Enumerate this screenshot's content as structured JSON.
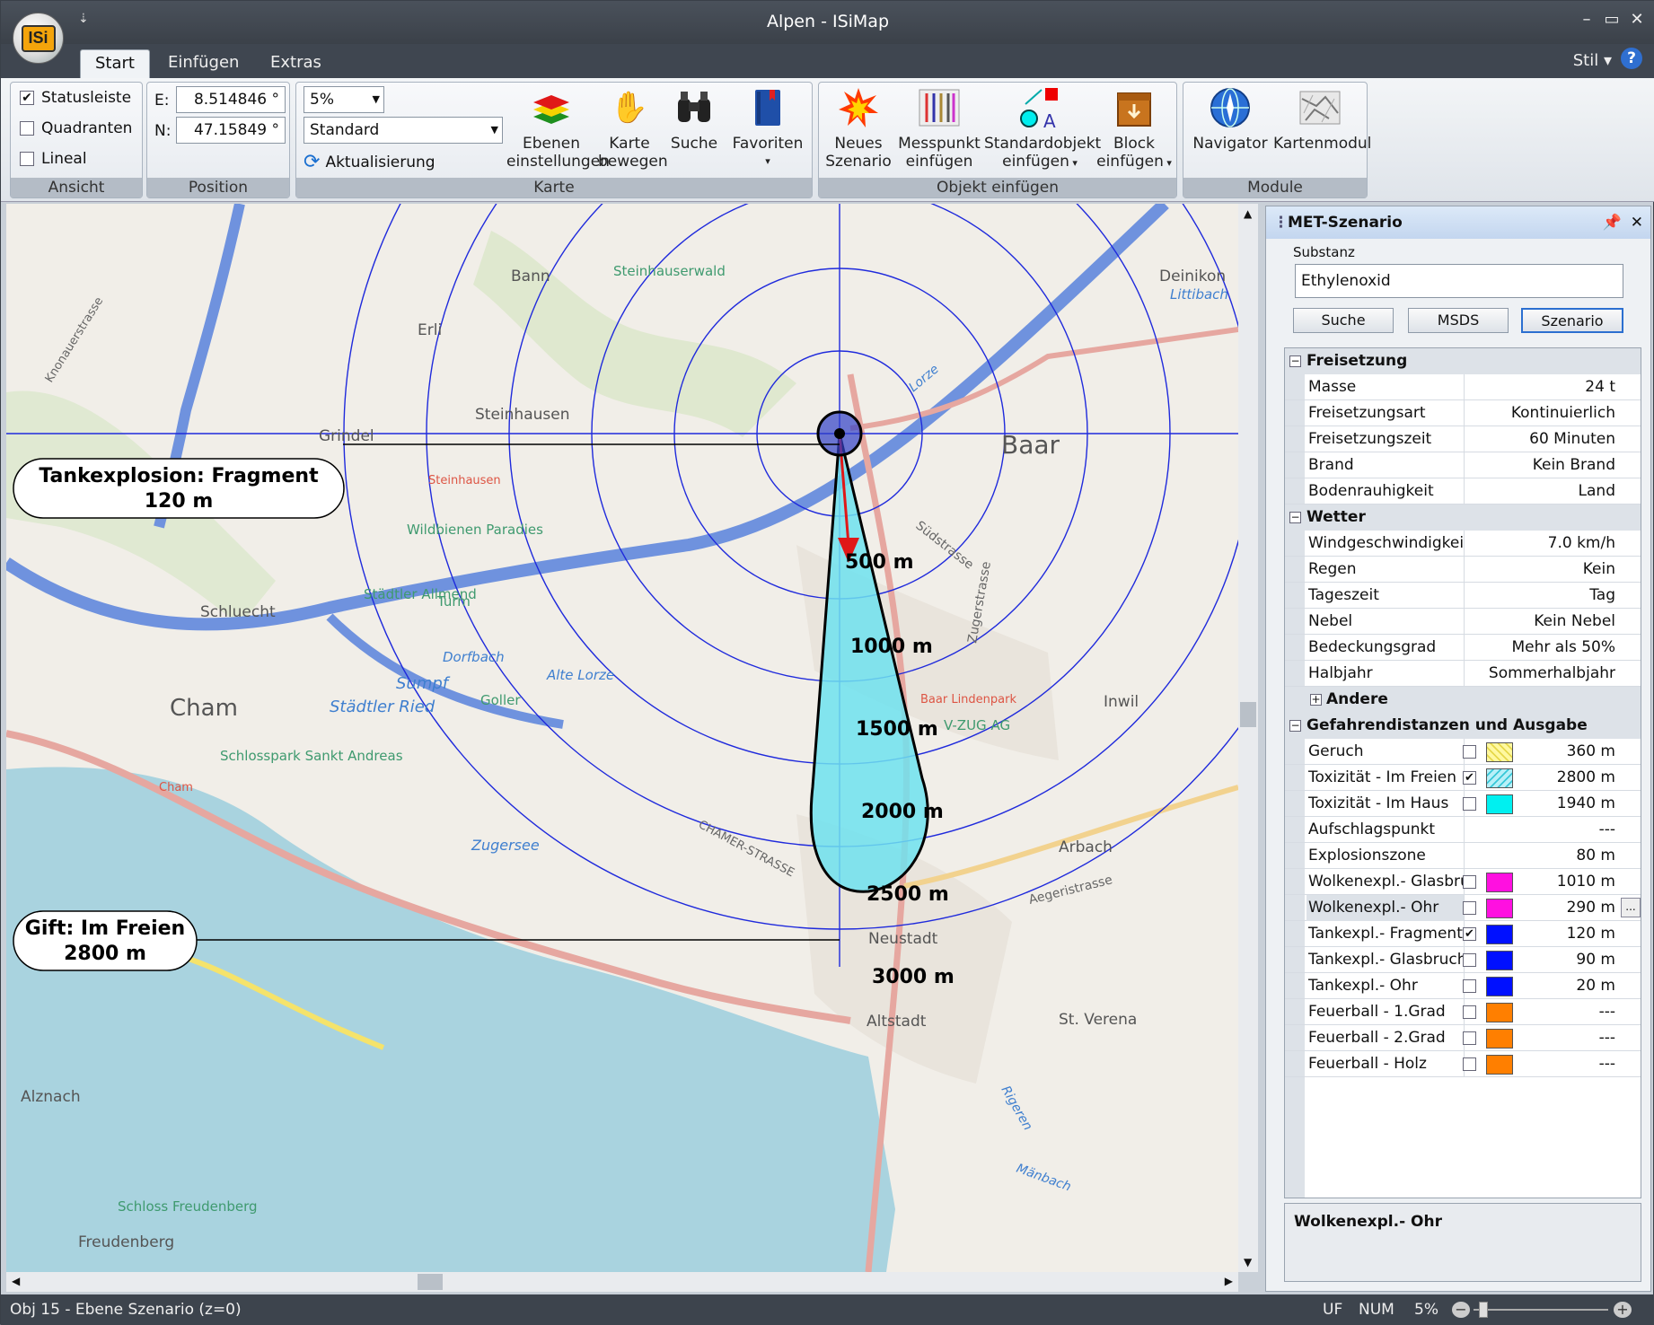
{
  "window": {
    "title": "Alpen - ISiMap",
    "logo": "ISi"
  },
  "tabs": [
    "Start",
    "Einfügen",
    "Extras"
  ],
  "style_menu": "Stil",
  "ribbon": {
    "ansicht": {
      "caption": "Ansicht",
      "items": [
        {
          "label": "Statusleiste",
          "checked": true
        },
        {
          "label": "Quadranten",
          "checked": false
        },
        {
          "label": "Lineal",
          "checked": false
        }
      ]
    },
    "position": {
      "caption": "Position",
      "e_label": "E:",
      "e_value": "8.514846 °",
      "n_label": "N:",
      "n_value": "47.15849 °"
    },
    "karte": {
      "caption": "Karte",
      "zoom": "5%",
      "style": "Standard",
      "refresh": "Aktualisierung",
      "btn_layers_1": "Ebenen",
      "btn_layers_2": "einstellungen",
      "btn_move_1": "Karte",
      "btn_move_2": "bewegen",
      "btn_search": "Suche",
      "btn_fav": "Favoriten"
    },
    "objekt": {
      "caption": "Objekt einfügen",
      "b1a": "Neues",
      "b1b": "Szenario",
      "b2a": "Messpunkt",
      "b2b": "einfügen",
      "b3a": "Standardobjekt",
      "b3b": "einfügen",
      "b4a": "Block",
      "b4b": "einfügen"
    },
    "module": {
      "caption": "Module",
      "b1": "Navigator",
      "b2": "Kartenmodul"
    }
  },
  "map": {
    "callout1": {
      "line1": "Tankexplosion: Fragment",
      "line2": "120 m"
    },
    "callout2": {
      "line1": "Gift: Im Freien",
      "line2": "2800 m"
    },
    "rings": [
      {
        "label": "500 m",
        "r": 500
      },
      {
        "label": "1000 m",
        "r": 1000
      },
      {
        "label": "1500 m",
        "r": 1500
      },
      {
        "label": "2000 m",
        "r": 2000
      },
      {
        "label": "2500 m",
        "r": 2500
      },
      {
        "label": "3000 m",
        "r": 3000
      }
    ],
    "places": [
      "Bann",
      "Erli",
      "Grindel",
      "Steinhausen",
      "Steinhauserwald",
      "Deinikon",
      "Littibach",
      "Baar",
      "Schluecht",
      "Cham",
      "Städtler Ried",
      "Sumpf",
      "Alte Lorze",
      "Goller",
      "Städtler Allmend",
      "Turm",
      "Dorfbach",
      "Wildbienen Paradies",
      "Schlosspark Sankt Andreas",
      "Zugersee",
      "Inwil",
      "V-ZUG AG",
      "Arbach",
      "Neustadt",
      "Altstadt",
      "St. Verena",
      "Alznach",
      "Schloss Freudenberg",
      "Freudenberg",
      "Knonauerstrasse",
      "Zugerstrasse",
      "Südstrasse",
      "Aegeristrasse",
      "CHAMER-STRASSE",
      "Lorze",
      "Baar Lindenpark",
      "Steinhausen",
      "Cham",
      "Rigeren",
      "Mänbach"
    ]
  },
  "panel": {
    "title": "MET-Szenario",
    "substance_label": "Substanz",
    "substance": "Ethylenoxid",
    "btn_search": "Suche",
    "btn_msds": "MSDS",
    "btn_scenario": "Szenario",
    "cat_release": "Freisetzung",
    "release": [
      [
        "Masse",
        "24 t"
      ],
      [
        "Freisetzungsart",
        "Kontinuierlich"
      ],
      [
        "Freisetzungszeit",
        "60 Minuten"
      ],
      [
        "Brand",
        "Kein Brand"
      ],
      [
        "Bodenrauhigkeit",
        "Land"
      ]
    ],
    "cat_weather": "Wetter",
    "weather": [
      [
        "Windgeschwindigkeit",
        "7.0 km/h"
      ],
      [
        "Regen",
        "Kein"
      ],
      [
        "Tageszeit",
        "Tag"
      ],
      [
        "Nebel",
        "Kein Nebel"
      ],
      [
        "Bedeckungsgrad",
        "Mehr als 50%"
      ],
      [
        "Halbjahr",
        "Sommerhalbjahr"
      ]
    ],
    "cat_other": "Andere",
    "cat_hazard": "Gefahrendistanzen und Ausgabe",
    "hazard": [
      {
        "k": "Geruch",
        "v": "360 m",
        "checked": false,
        "color": "#fff8a0"
      },
      {
        "k": "Toxizität - Im Freien",
        "v": "2800 m",
        "checked": true,
        "color": "#b8f0f8"
      },
      {
        "k": "Toxizität - Im Haus",
        "v": "1940 m",
        "checked": false,
        "color": "#00f0f0"
      },
      {
        "k": "Aufschlagspunkt",
        "v": "---",
        "checked": null,
        "color": null
      },
      {
        "k": "Explosionszone",
        "v": "80 m",
        "checked": null,
        "color": null
      },
      {
        "k": "Wolkenexpl.- Glasbru",
        "v": "1010 m",
        "checked": false,
        "color": "#ff10e0"
      },
      {
        "k": "Wolkenexpl.- Ohr",
        "v": "290 m",
        "checked": false,
        "color": "#ff10e0"
      },
      {
        "k": "Tankexpl.- Fragment",
        "v": "120 m",
        "checked": true,
        "color": "#0010ff"
      },
      {
        "k": "Tankexpl.- Glasbruch",
        "v": "90 m",
        "checked": false,
        "color": "#0010ff"
      },
      {
        "k": "Tankexpl.- Ohr",
        "v": "20 m",
        "checked": false,
        "color": "#0010ff"
      },
      {
        "k": "Feuerball - 1.Grad",
        "v": "---",
        "checked": false,
        "color": "#ff7f00"
      },
      {
        "k": "Feuerball - 2.Grad",
        "v": "---",
        "checked": false,
        "color": "#ff7f00"
      },
      {
        "k": "Feuerball - Holz",
        "v": "---",
        "checked": false,
        "color": "#ff7f00"
      }
    ],
    "description": "Wolkenexpl.- Ohr"
  },
  "status": {
    "left": "Obj 15 - Ebene Szenario (z=0)",
    "uf": "UF",
    "num": "NUM",
    "zoom": "5%"
  }
}
